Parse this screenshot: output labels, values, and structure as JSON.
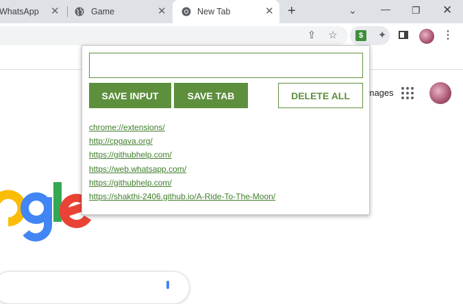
{
  "tabs": [
    {
      "label": "WhatsApp"
    },
    {
      "label": "Game"
    },
    {
      "label": "New Tab",
      "active": true
    }
  ],
  "toolbar": {
    "extension_badge": "$"
  },
  "ntp": {
    "images_link": "Images"
  },
  "popup": {
    "input": {
      "value": "",
      "placeholder": ""
    },
    "buttons": {
      "save_input": "SAVE INPUT",
      "save_tab": "SAVE TAB",
      "delete_all": "DELETE ALL"
    },
    "links": [
      "chrome://extensions/",
      "http://cpgava.org/",
      "https://githubhelp.com/",
      "https://web.whatsapp.com/",
      "https://githubhelp.com/",
      "https://shakthi-2406.github.io/A-Ride-To-The-Moon/"
    ]
  },
  "colors": {
    "accent_green": "#5d8f3d",
    "link_green": "#3f7d2a",
    "tabstrip_bg": "#dee1e6"
  },
  "icons": {
    "tab_game": "globe-icon",
    "tab_newtab": "chrome-icon",
    "toolbar": [
      "share-icon",
      "star-icon",
      "extension-icon",
      "puzzle-icon",
      "side-panel-icon",
      "avatar",
      "menu-icon"
    ]
  }
}
